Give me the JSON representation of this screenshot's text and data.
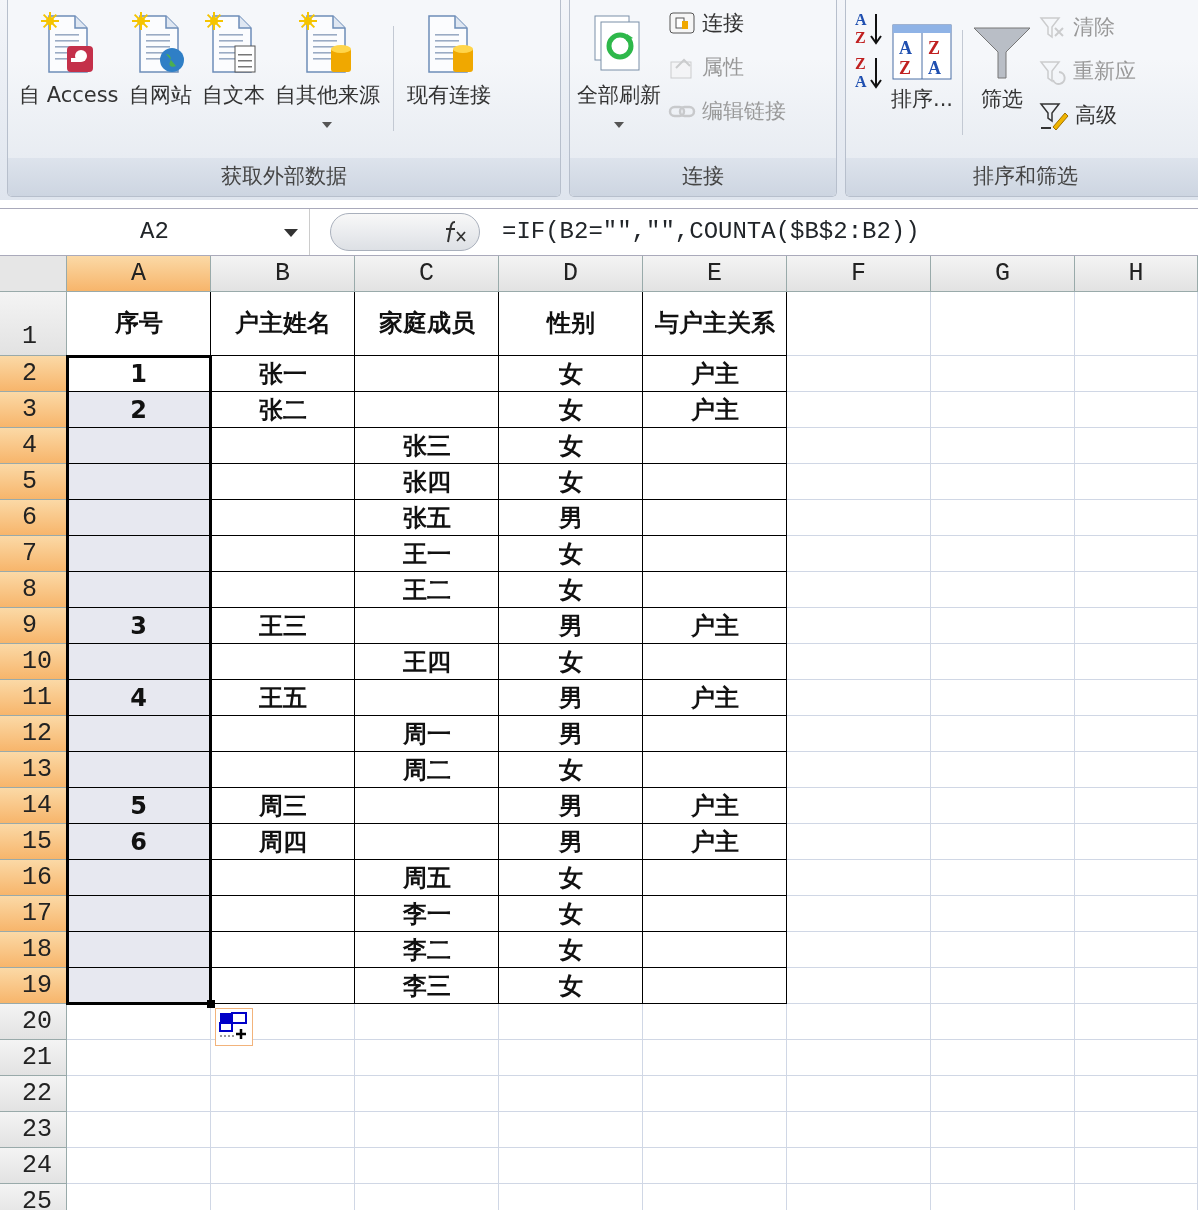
{
  "ribbon": {
    "groups": [
      {
        "title": "获取外部数据",
        "items": [
          {
            "kind": "large",
            "label": "自 Access",
            "disabled": false,
            "dropdown": false
          },
          {
            "kind": "large",
            "label": "自网站",
            "disabled": false,
            "dropdown": false
          },
          {
            "kind": "large",
            "label": "自文本",
            "disabled": false,
            "dropdown": false
          },
          {
            "kind": "large",
            "label": "自其他来源",
            "disabled": false,
            "dropdown": true
          },
          {
            "kind": "separator"
          },
          {
            "kind": "large",
            "label": "现有连接",
            "disabled": false,
            "dropdown": false
          }
        ]
      },
      {
        "title": "连接",
        "items": [
          {
            "kind": "large",
            "label": "全部刷新",
            "disabled": false,
            "dropdown": true
          },
          {
            "kind": "small",
            "label": "连接",
            "disabled": false,
            "dropdown": false
          },
          {
            "kind": "small",
            "label": "属性",
            "disabled": true,
            "dropdown": false
          },
          {
            "kind": "small",
            "label": "编辑链接",
            "disabled": true,
            "dropdown": false
          }
        ]
      },
      {
        "title": "排序和筛选",
        "items": [
          {
            "kind": "small",
            "letters": [
              "A",
              "Z"
            ],
            "disabled": false,
            "dropdown": false
          },
          {
            "kind": "small",
            "letters": [
              "Z",
              "A"
            ],
            "disabled": false,
            "dropdown": false
          },
          {
            "kind": "large",
            "label": "排序...",
            "letters": [
              "A",
              "Z",
              "Z",
              "A"
            ],
            "disabled": false,
            "dropdown": false
          },
          {
            "kind": "separator"
          },
          {
            "kind": "large",
            "label": "筛选",
            "disabled": false,
            "dropdown": false
          },
          {
            "kind": "small",
            "label": "清除",
            "disabled": true,
            "dropdown": false
          },
          {
            "kind": "small",
            "label": "重新应",
            "disabled": true,
            "dropdown": false
          },
          {
            "kind": "small",
            "label": "高级",
            "disabled": false,
            "dropdown": false
          }
        ]
      }
    ]
  },
  "formula_bar": {
    "name_box": "A2",
    "formula": "=IF(B2=\"\",\"\",COUNTA($B$2:B2))"
  },
  "sheet": {
    "columns": [
      {
        "label": "A",
        "selected": true
      },
      {
        "label": "B",
        "selected": false
      },
      {
        "label": "C",
        "selected": false
      },
      {
        "label": "D",
        "selected": false
      },
      {
        "label": "E",
        "selected": false
      },
      {
        "label": "F",
        "selected": false
      },
      {
        "label": "G",
        "selected": false
      },
      {
        "label": "H",
        "selected": false
      }
    ],
    "rows": [
      {
        "header": "1",
        "selected": false,
        "cells": [
          "序号",
          "户主姓名",
          "家庭成员",
          "性别",
          "与户主关系"
        ]
      },
      {
        "header": "2",
        "selected": true,
        "cells": [
          "1",
          "张一",
          null,
          "女",
          "户主"
        ]
      },
      {
        "header": "3",
        "selected": true,
        "cells": [
          "2",
          "张二",
          null,
          "女",
          "户主"
        ]
      },
      {
        "header": "4",
        "selected": true,
        "cells": [
          null,
          null,
          "张三",
          "女",
          null
        ]
      },
      {
        "header": "5",
        "selected": true,
        "cells": [
          null,
          null,
          "张四",
          "女",
          null
        ]
      },
      {
        "header": "6",
        "selected": true,
        "cells": [
          null,
          null,
          "张五",
          "男",
          null
        ]
      },
      {
        "header": "7",
        "selected": true,
        "cells": [
          null,
          null,
          "王一",
          "女",
          null
        ]
      },
      {
        "header": "8",
        "selected": true,
        "cells": [
          null,
          null,
          "王二",
          "女",
          null
        ]
      },
      {
        "header": "9",
        "selected": true,
        "cells": [
          "3",
          "王三",
          null,
          "男",
          "户主"
        ]
      },
      {
        "header": "10",
        "selected": true,
        "cells": [
          null,
          null,
          "王四",
          "女",
          null
        ]
      },
      {
        "header": "11",
        "selected": true,
        "cells": [
          "4",
          "王五",
          null,
          "男",
          "户主"
        ]
      },
      {
        "header": "12",
        "selected": true,
        "cells": [
          null,
          null,
          "周一",
          "男",
          null
        ]
      },
      {
        "header": "13",
        "selected": true,
        "cells": [
          null,
          null,
          "周二",
          "女",
          null
        ]
      },
      {
        "header": "14",
        "selected": true,
        "cells": [
          "5",
          "周三",
          null,
          "男",
          "户主"
        ]
      },
      {
        "header": "15",
        "selected": true,
        "cells": [
          "6",
          "周四",
          null,
          "男",
          "户主"
        ]
      },
      {
        "header": "16",
        "selected": true,
        "cells": [
          null,
          null,
          "周五",
          "女",
          null
        ]
      },
      {
        "header": "17",
        "selected": true,
        "cells": [
          null,
          null,
          "李一",
          "女",
          null
        ]
      },
      {
        "header": "18",
        "selected": true,
        "cells": [
          null,
          null,
          "李二",
          "女",
          null
        ]
      },
      {
        "header": "19",
        "selected": true,
        "cells": [
          null,
          null,
          "李三",
          "女",
          null
        ]
      },
      {
        "header": "20",
        "selected": false
      },
      {
        "header": "21",
        "selected": false
      },
      {
        "header": "22",
        "selected": false
      },
      {
        "header": "23",
        "selected": false
      },
      {
        "header": "24",
        "selected": false
      },
      {
        "header": "25",
        "selected": false
      }
    ]
  }
}
